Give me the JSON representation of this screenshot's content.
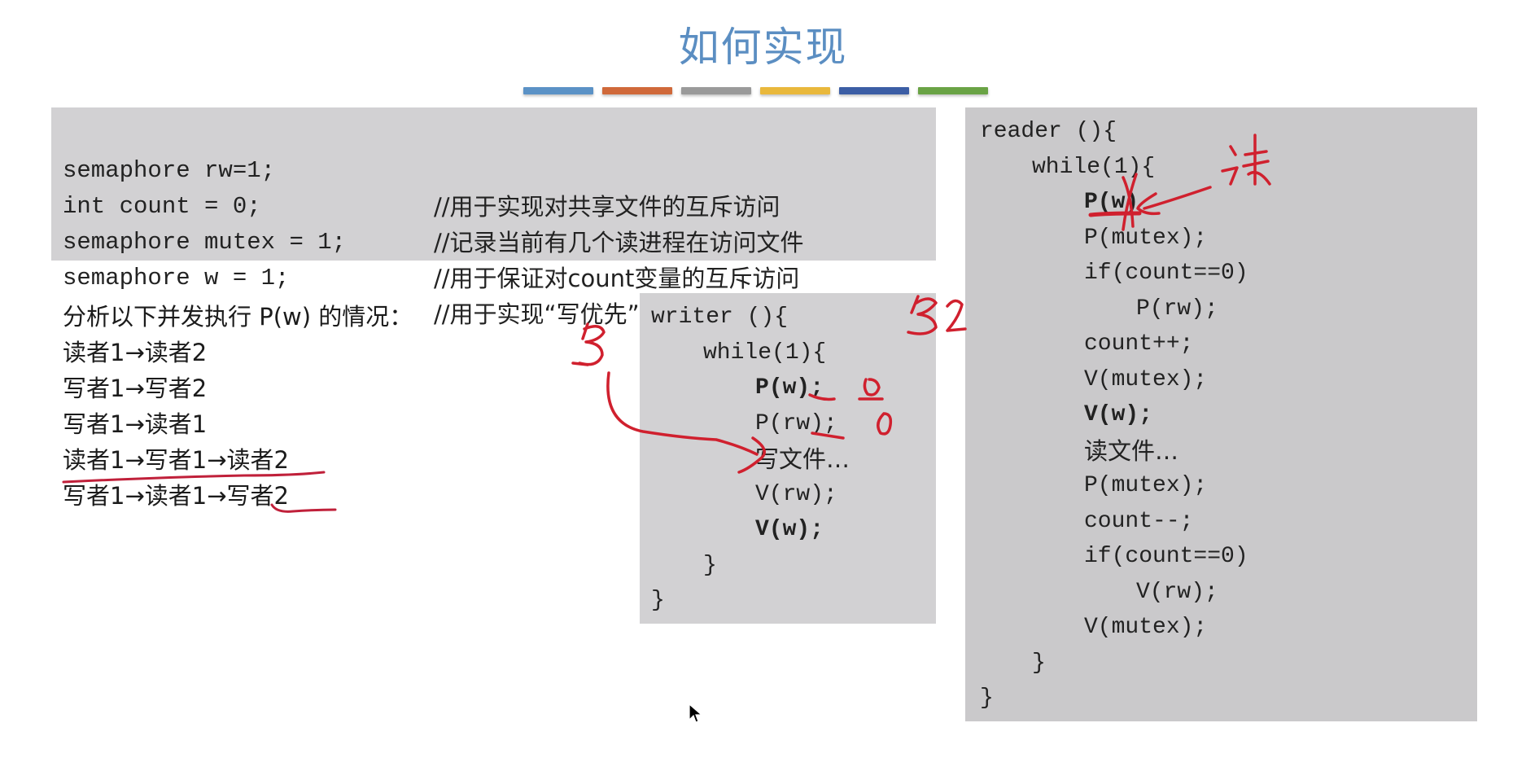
{
  "slide": {
    "title": "如何实现",
    "accent_bars": [
      "#5b92c6",
      "#d0693a",
      "#9a9a9a",
      "#e9b83c",
      "#3c5ea5",
      "#6aa345"
    ]
  },
  "declarations": [
    {
      "code": "semaphore rw=1;",
      "comment": "//用于实现对共享文件的互斥访问"
    },
    {
      "code": "int count = 0;",
      "comment": "//记录当前有几个读进程在访问文件"
    },
    {
      "code": "semaphore mutex = 1;",
      "comment": "//用于保证对count变量的互斥访问"
    },
    {
      "code": "semaphore w = 1;",
      "comment": "//用于实现“写优先”"
    }
  ],
  "analysis": {
    "heading": "分析以下并发执行 P(w) 的情况：",
    "cases": [
      "读者1→读者2",
      "写者1→写者2",
      "写者1→读者1",
      "读者1→写者1→读者2",
      "写者1→读者1→写者2"
    ]
  },
  "writer": {
    "lines": [
      {
        "text": "writer (){",
        "indent": 0,
        "bold": false
      },
      {
        "text": "while(1){",
        "indent": 1,
        "bold": false
      },
      {
        "text": "P(w);",
        "indent": 2,
        "bold": true
      },
      {
        "text": "P(rw);",
        "indent": 2,
        "bold": false
      },
      {
        "text": "写文件…",
        "indent": 2,
        "bold": false,
        "cjk": true
      },
      {
        "text": "V(rw);",
        "indent": 2,
        "bold": false
      },
      {
        "text": "V(w);",
        "indent": 2,
        "bold": true
      },
      {
        "text": "}",
        "indent": 1,
        "bold": false
      },
      {
        "text": "}",
        "indent": 0,
        "bold": false
      }
    ]
  },
  "reader": {
    "lines": [
      {
        "text": "reader (){",
        "indent": 0,
        "bold": false
      },
      {
        "text": "while(1){",
        "indent": 1,
        "bold": false
      },
      {
        "text": "P(w)",
        "indent": 2,
        "bold": true
      },
      {
        "text": "P(mutex);",
        "indent": 2,
        "bold": false
      },
      {
        "text": "if(count==0)",
        "indent": 2,
        "bold": false
      },
      {
        "text": "P(rw);",
        "indent": 3,
        "bold": false
      },
      {
        "text": "count++;",
        "indent": 2,
        "bold": false
      },
      {
        "text": "V(mutex);",
        "indent": 2,
        "bold": false
      },
      {
        "text": "V(w);",
        "indent": 2,
        "bold": true
      },
      {
        "text": "读文件…",
        "indent": 2,
        "bold": false,
        "cjk": true
      },
      {
        "text": "P(mutex);",
        "indent": 2,
        "bold": false
      },
      {
        "text": "count--;",
        "indent": 2,
        "bold": false
      },
      {
        "text": "if(count==0)",
        "indent": 2,
        "bold": false
      },
      {
        "text": "V(rw);",
        "indent": 3,
        "bold": false
      },
      {
        "text": "V(mutex);",
        "indent": 2,
        "bold": false
      },
      {
        "text": "}",
        "indent": 1,
        "bold": false
      },
      {
        "text": "}",
        "indent": 0,
        "bold": false
      }
    ]
  },
  "annotations": {
    "color": "#d0202e",
    "writer_label": "写",
    "writer2_label": "写2",
    "reader_label": "读",
    "w_value": "0",
    "rw_value": "0"
  }
}
